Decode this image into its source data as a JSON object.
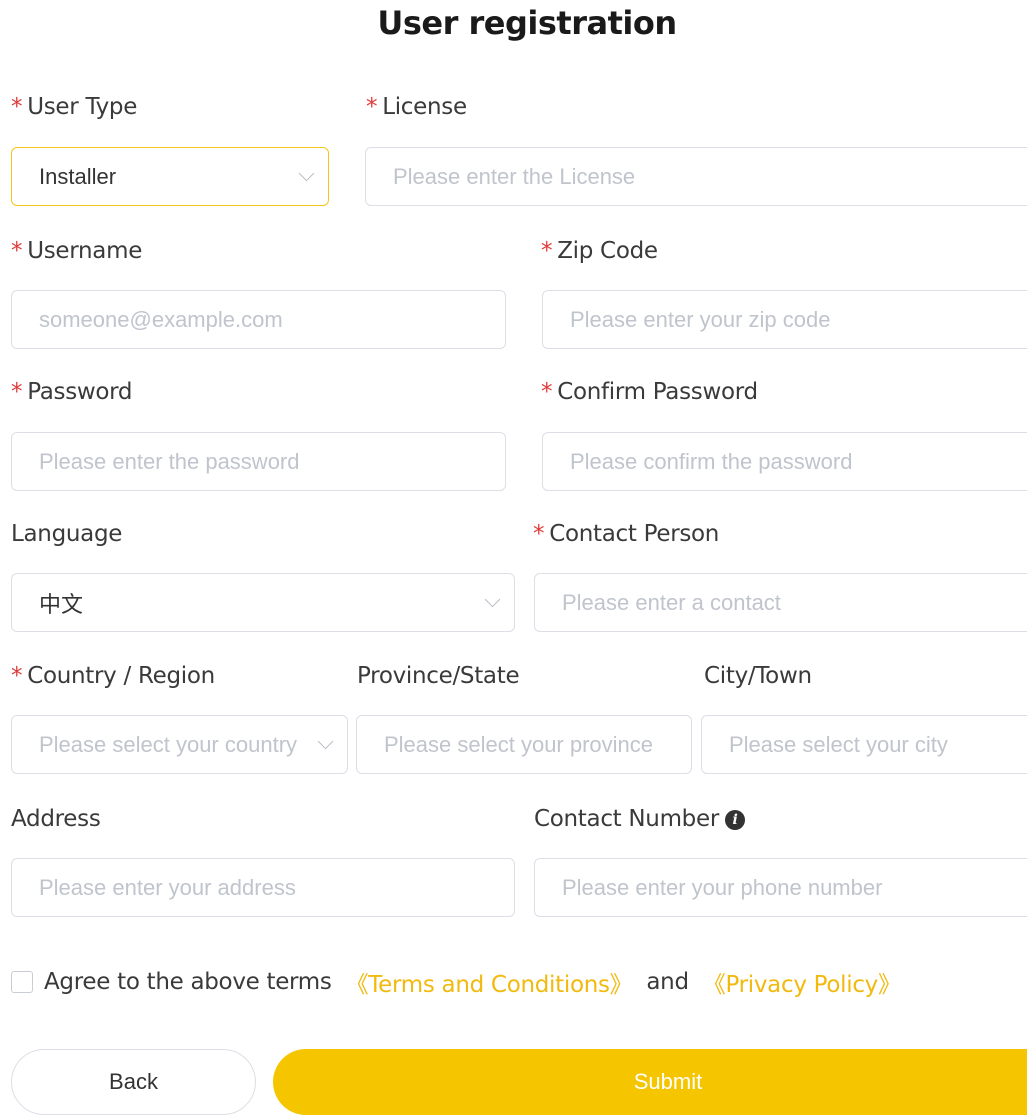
{
  "page": {
    "title": "User registration"
  },
  "form": {
    "user_type": {
      "label": "User Type",
      "required": true,
      "value": "Installer"
    },
    "license": {
      "label": "License",
      "required": true,
      "placeholder": "Please enter the License"
    },
    "username": {
      "label": "Username",
      "required": true,
      "placeholder": "someone@example.com"
    },
    "zip_code": {
      "label": "Zip Code",
      "required": true,
      "placeholder": "Please enter your zip code"
    },
    "password": {
      "label": "Password",
      "required": true,
      "placeholder": "Please enter the password"
    },
    "confirm_password": {
      "label": "Confirm Password",
      "required": true,
      "placeholder": "Please confirm the password"
    },
    "language": {
      "label": "Language",
      "required": false,
      "value": "中文"
    },
    "contact_person": {
      "label": "Contact Person",
      "required": true,
      "placeholder": "Please enter a contact"
    },
    "country": {
      "label": "Country / Region",
      "required": true,
      "placeholder": "Please select your country"
    },
    "province": {
      "label": "Province/State",
      "required": false,
      "placeholder": "Please select your province"
    },
    "city": {
      "label": "City/Town",
      "required": false,
      "placeholder": "Please select your city"
    },
    "address": {
      "label": "Address",
      "required": false,
      "placeholder": "Please enter your address"
    },
    "contact_number": {
      "label": "Contact Number",
      "required": false,
      "placeholder": "Please enter your phone number"
    }
  },
  "agreement": {
    "text": "Agree to the above terms",
    "terms_link": "《Terms and Conditions》",
    "and": "and",
    "privacy_link": "《Privacy Policy》",
    "checked": false
  },
  "buttons": {
    "back": "Back",
    "submit": "Submit"
  },
  "colors": {
    "accent": "#f5c500",
    "required": "#e03a3a",
    "link": "#f2b90f"
  },
  "icons": {
    "info": "info-icon",
    "dropdown": "chevron-down-icon"
  }
}
